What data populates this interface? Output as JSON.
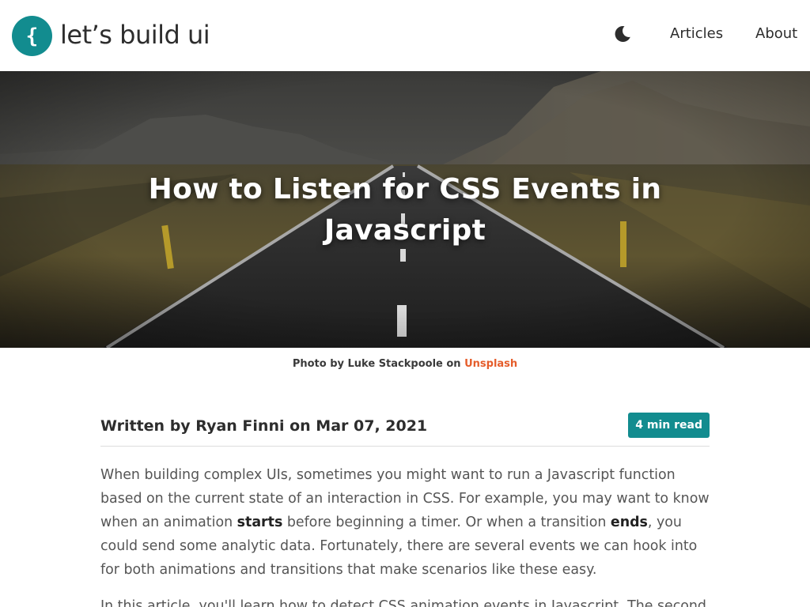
{
  "header": {
    "logo_glyph": "{",
    "logo_text": "let’s build ui",
    "theme_icon": "moon-icon",
    "nav": [
      {
        "label": "Articles"
      },
      {
        "label": "About"
      }
    ]
  },
  "hero": {
    "title": "How to Listen for CSS Events in Javascript"
  },
  "caption": {
    "prefix": "Photo by Luke Stackpoole on",
    "link": "Unsplash"
  },
  "meta": {
    "byline": "Written by Ryan Finni on Mar 07, 2021",
    "read_time": "4 min read"
  },
  "article": {
    "p1": {
      "a": "When building complex UIs, sometimes you might want to run a Javascript function based on the current state of an interaction in CSS. For example, you may want to know when an animation ",
      "b": "starts",
      "c": " before beginning a timer. Or when a transition ",
      "d": "ends",
      "e": ", you could send some analytic data. Fortunately, there are several events we can hook into for both animations and transitions that make scenarios like these easy."
    },
    "p2": "In this article, you'll learn how to detect CSS animation events in Javascript. The second"
  },
  "colors": {
    "brand": "#128c8f",
    "link": "#e55d2b"
  }
}
